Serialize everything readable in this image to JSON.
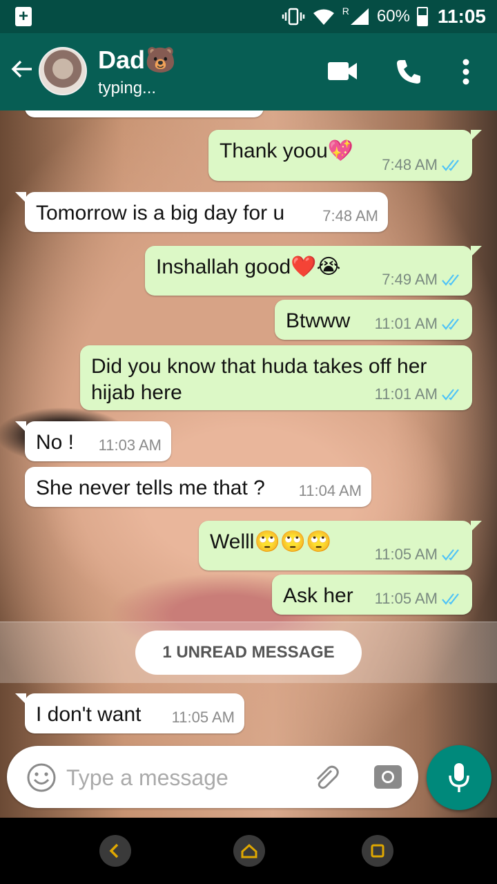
{
  "status_bar": {
    "battery_percent": "60%",
    "network_label": "R",
    "time": "11:05"
  },
  "header": {
    "contact_name": "Dad🐻",
    "contact_status": "typing..."
  },
  "messages": [
    {
      "direction": "out",
      "text": "Thank yoou💖",
      "time": "7:48 AM",
      "status": "read"
    },
    {
      "direction": "in",
      "text": "Tomorrow is a big day for u",
      "time": "7:48 AM"
    },
    {
      "direction": "out",
      "text": "Inshallah good❤️😭",
      "time": "7:49 AM",
      "status": "read"
    },
    {
      "direction": "out",
      "text": "Btwww",
      "time": "11:01 AM",
      "status": "read"
    },
    {
      "direction": "out",
      "text": "Did you know that huda takes off her hijab here",
      "time": "11:01 AM",
      "status": "read"
    },
    {
      "direction": "in",
      "text": "No !",
      "time": "11:03 AM"
    },
    {
      "direction": "in",
      "text": "She never tells me that ?",
      "time": "11:04 AM"
    },
    {
      "direction": "out",
      "text": "Welll🙄🙄🙄",
      "time": "11:05 AM",
      "status": "read"
    },
    {
      "direction": "out",
      "text": "Ask her",
      "time": "11:05 AM",
      "status": "read"
    },
    {
      "direction": "in",
      "text": "I don't want",
      "time": "11:05 AM"
    }
  ],
  "unread_divider": "1 UNREAD MESSAGE",
  "composer": {
    "placeholder": "Type a message"
  },
  "colors": {
    "header": "#075e54",
    "status_bar": "#054d44",
    "outgoing_bubble": "#dcf8c6",
    "incoming_bubble": "#ffffff",
    "read_ticks": "#4fc3f7",
    "mic_button": "#00897b"
  },
  "icons": {
    "back": "arrow-left-icon",
    "video": "video-call-icon",
    "call": "phone-icon",
    "menu": "more-vertical-icon",
    "emoji": "emoji-icon",
    "attach": "paperclip-icon",
    "camera": "camera-icon",
    "mic": "microphone-icon"
  }
}
